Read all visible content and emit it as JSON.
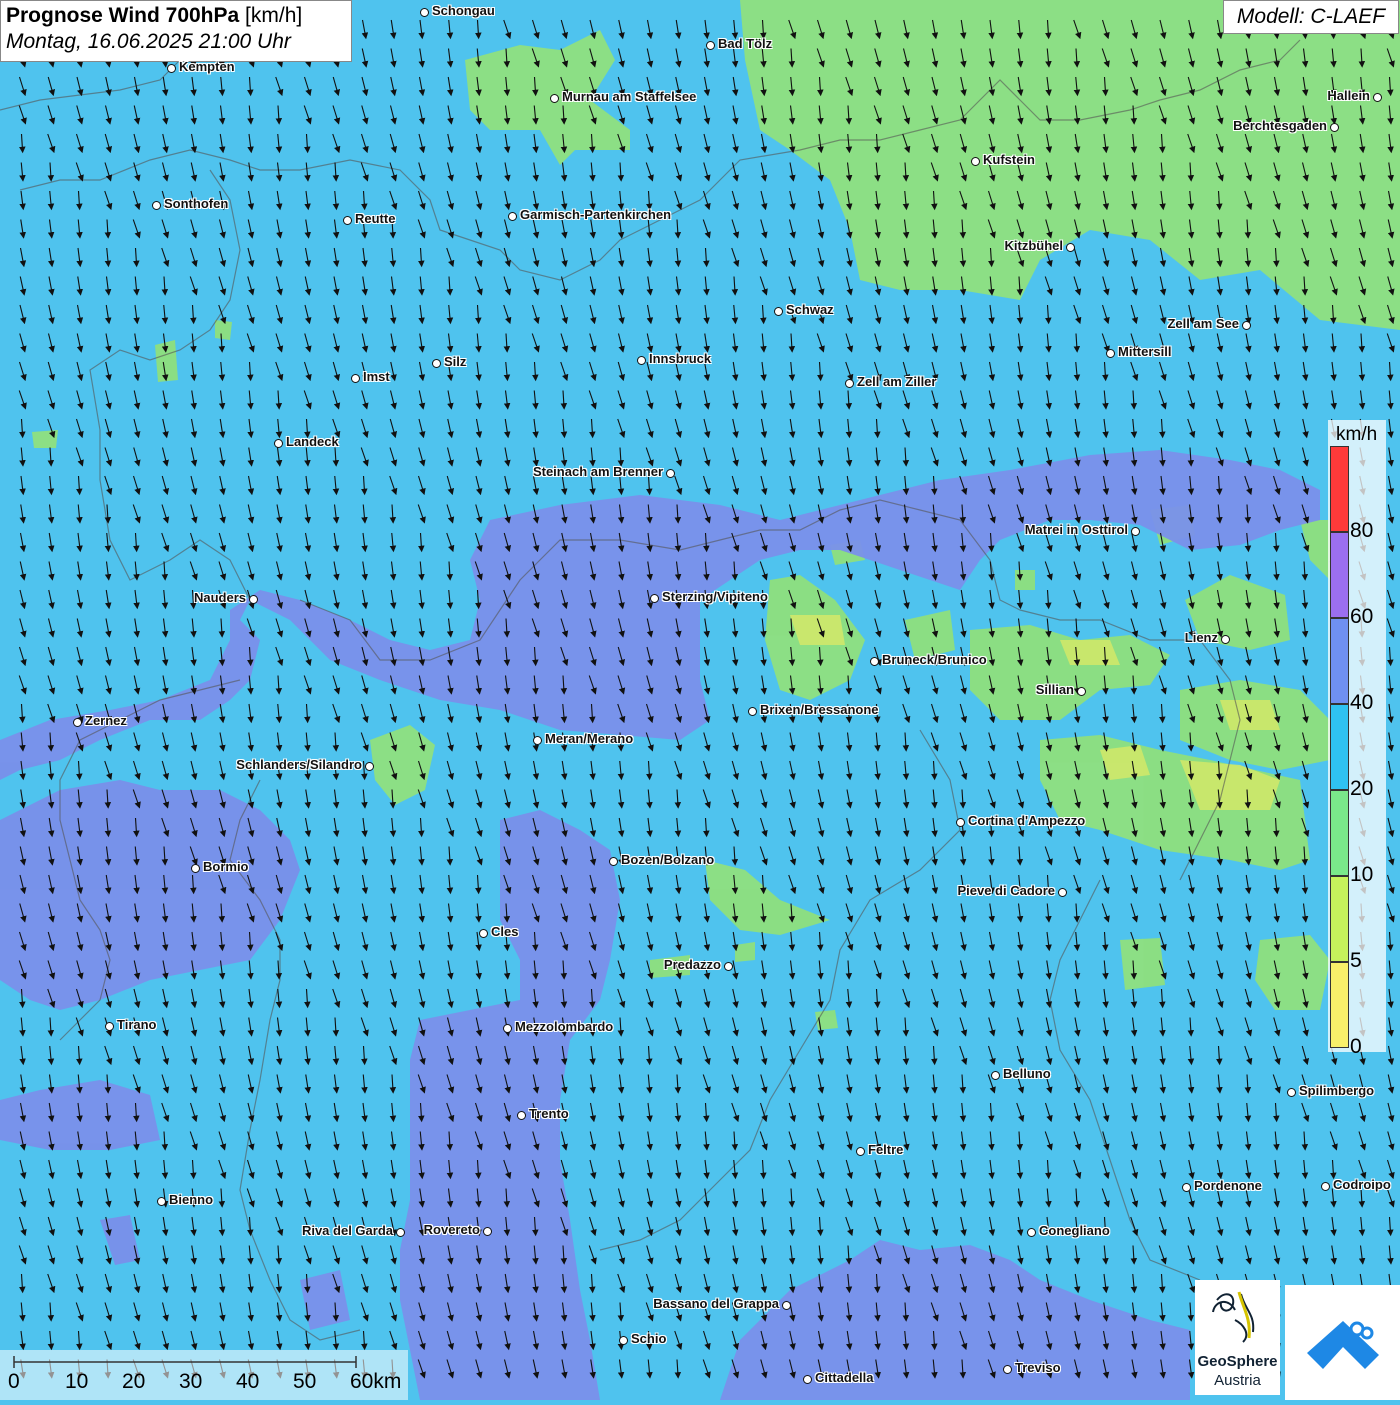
{
  "title": {
    "main": "Prognose Wind 700hPa",
    "unit": "[km/h]",
    "datetime": "Montag, 16.06.2025 21:00 Uhr"
  },
  "model": "Modell: C-LAEF",
  "colors": {
    "sea_blue": "#4fc3ee",
    "purple": "#7a90ea",
    "green": "#8fe07e",
    "yellow": "#cfe86a"
  },
  "cities": [
    {
      "name": "Schongau"
    },
    {
      "name": "Bad Tölz"
    },
    {
      "name": "Kempten"
    },
    {
      "name": "Murnau am Staffelsee"
    },
    {
      "name": "Hallein"
    },
    {
      "name": "Berchtesgaden"
    },
    {
      "name": "Kufstein"
    },
    {
      "name": "Sonthofen"
    },
    {
      "name": "Reutte"
    },
    {
      "name": "Garmisch-Partenkirchen"
    },
    {
      "name": "Kitzbühel"
    },
    {
      "name": "Schwaz"
    },
    {
      "name": "Zell am See"
    },
    {
      "name": "Mittersill"
    },
    {
      "name": "Imst"
    },
    {
      "name": "Silz"
    },
    {
      "name": "Innsbruck"
    },
    {
      "name": "Zell am Ziller"
    },
    {
      "name": "Landeck"
    },
    {
      "name": "Steinach am Brenner"
    },
    {
      "name": "Matrei in Osttirol"
    },
    {
      "name": "Nauders"
    },
    {
      "name": "Sterzing/Vipiteno"
    },
    {
      "name": "Lienz"
    },
    {
      "name": "Bruneck/Brunico"
    },
    {
      "name": "Sillian"
    },
    {
      "name": "Zernez"
    },
    {
      "name": "Brixen/Bressanone"
    },
    {
      "name": "Meran/Merano"
    },
    {
      "name": "Schlanders/Silandro"
    },
    {
      "name": "Cortina d'Ampezzo"
    },
    {
      "name": "Bozen/Bolzano"
    },
    {
      "name": "Bormio"
    },
    {
      "name": "Pieve di Cadore"
    },
    {
      "name": "Cles"
    },
    {
      "name": "Predazzo"
    },
    {
      "name": "Tirano"
    },
    {
      "name": "Mezzolombardo"
    },
    {
      "name": "Belluno"
    },
    {
      "name": "Spilimbergo"
    },
    {
      "name": "Trento"
    },
    {
      "name": "Feltre"
    },
    {
      "name": "Bienno"
    },
    {
      "name": "Pordenone"
    },
    {
      "name": "Codroipo"
    },
    {
      "name": "Riva del Garda"
    },
    {
      "name": "Rovereto"
    },
    {
      "name": "Conegliano"
    },
    {
      "name": "Bassano del Grappa"
    },
    {
      "name": "Schio"
    },
    {
      "name": "Treviso"
    },
    {
      "name": "Cittadella"
    }
  ],
  "legend": {
    "unit": "km/h",
    "ticks": [
      "80",
      "60",
      "40",
      "20",
      "10",
      "5",
      "0"
    ],
    "bands": [
      {
        "color": "#ff3a3a"
      },
      {
        "color": "#9b6ff0"
      },
      {
        "color": "#6f90f2"
      },
      {
        "color": "#2fc2f2"
      },
      {
        "color": "#7ae88a"
      },
      {
        "color": "#c6f25c"
      },
      {
        "color": "#f8f06a"
      }
    ]
  },
  "scale": {
    "labels": [
      "0",
      "10",
      "20",
      "30",
      "40",
      "50",
      "60km"
    ]
  },
  "logos": {
    "geosphere_line1": "GeoSphere",
    "geosphere_line2": "Austria"
  }
}
